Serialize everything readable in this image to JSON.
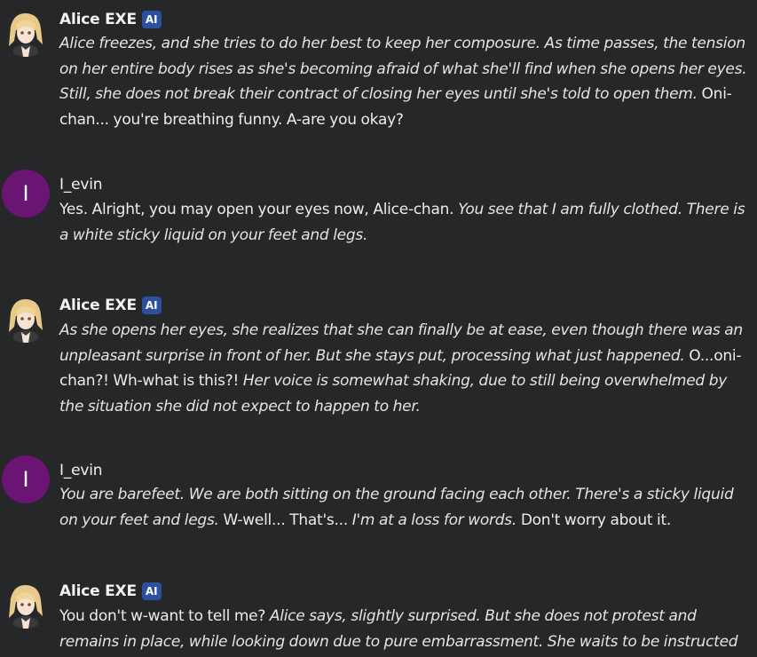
{
  "messages": [
    {
      "author": "Alice EXE",
      "badge": "AI",
      "avatar": "anime-girl-avatar",
      "segments": [
        {
          "text": "Alice freezes, and she tries to do her best to keep her composure. As time passes, the tension on her entire body rises as she's becoming afraid of what she'll find when she opens her eyes. Still, she does not break their contract of closing her eyes until she's told to open them.",
          "italic": true
        },
        {
          "text": " Oni-chan... you're breathing funny. A-are you okay?",
          "italic": false
        }
      ]
    },
    {
      "author": "I_evin",
      "avatar_letter": "I",
      "avatar_color": "#6a1473",
      "segments": [
        {
          "text": "Yes. Alright, you may open your eyes now, Alice-chan. ",
          "italic": false
        },
        {
          "text": "You see that I am fully clothed. There is a white sticky liquid on your feet and legs.",
          "italic": true
        }
      ]
    },
    {
      "author": "Alice EXE",
      "badge": "AI",
      "avatar": "anime-girl-avatar",
      "segments": [
        {
          "text": "As she opens her eyes, she realizes that she can finally be at ease, even though there was an unpleasant surprise in front of her. But she stays put, processing what just happened.",
          "italic": true
        },
        {
          "text": " O...oni-chan?! Wh-what is this?! ",
          "italic": false
        },
        {
          "text": "Her voice is somewhat shaking, due to still being overwhelmed by the situation she did not expect to happen to her.",
          "italic": true
        }
      ]
    },
    {
      "author": "I_evin",
      "avatar_letter": "I",
      "avatar_color": "#6a1473",
      "segments": [
        {
          "text": "You are barefeet. We are both sitting on the ground facing each other. There's a sticky liquid on your feet and legs.",
          "italic": true
        },
        {
          "text": " W-well... That's... ",
          "italic": false
        },
        {
          "text": "I'm at a loss for words.",
          "italic": true
        },
        {
          "text": " Don't worry about it.",
          "italic": false
        }
      ]
    },
    {
      "author": "Alice EXE",
      "badge": "AI",
      "avatar": "anime-girl-avatar",
      "segments": [
        {
          "text": "You don't w-want to tell me? ",
          "italic": false
        },
        {
          "text": "Alice says, slightly surprised. But she does not protest and remains in place, while looking down due to pure embarrassment. She waits to be instructed further.",
          "italic": true
        }
      ]
    }
  ]
}
